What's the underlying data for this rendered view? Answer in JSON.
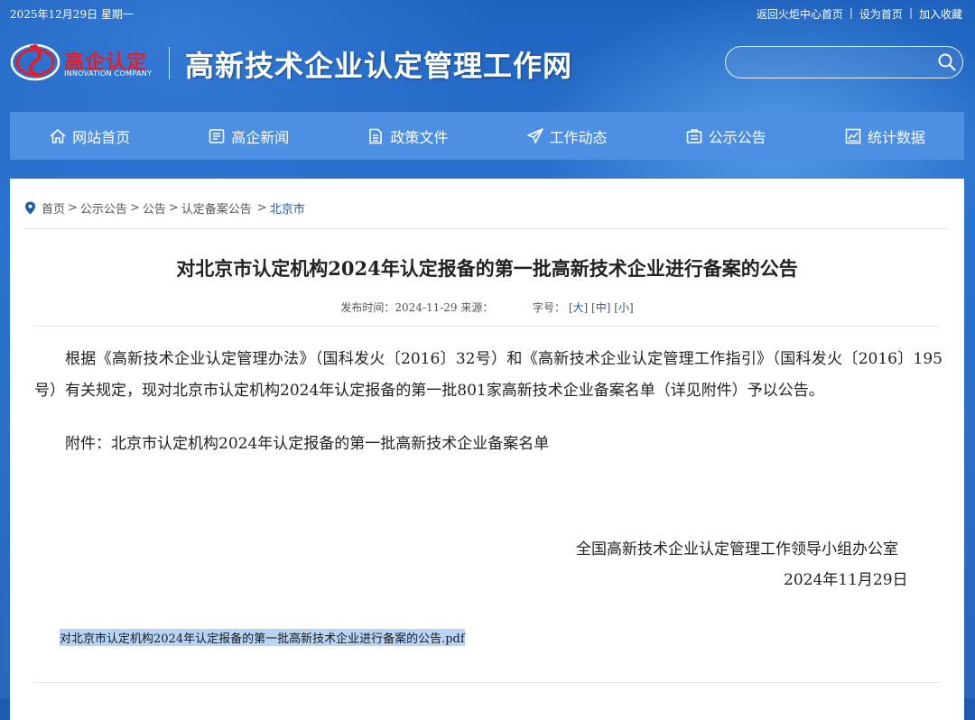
{
  "topbar": {
    "date": "2025年12月29日 星期一",
    "links": [
      "返回火炬中心首页",
      "设为首页",
      "加入收藏"
    ]
  },
  "logo": {
    "cn": "高企认定",
    "en": "INNOVATION COMPANY"
  },
  "site_title": "高新技术企业认定管理工作网",
  "search": {
    "placeholder": ""
  },
  "nav": [
    {
      "label": "网站首页",
      "icon": "home-icon"
    },
    {
      "label": "高企新闻",
      "icon": "news-icon"
    },
    {
      "label": "政策文件",
      "icon": "document-icon"
    },
    {
      "label": "工作动态",
      "icon": "paper-plane-icon"
    },
    {
      "label": "公示公告",
      "icon": "notice-icon"
    },
    {
      "label": "统计数据",
      "icon": "chart-icon"
    }
  ],
  "breadcrumb": [
    "首页",
    "公示公告",
    "公告",
    "认定备案公告"
  ],
  "breadcrumb_current": "北京市",
  "article": {
    "title": "对北京市认定机构2024年认定报备的第一批高新技术企业进行备案的公告",
    "meta_prefix": "发布时间：2024-11-29 来源：",
    "font_label": "字号：",
    "font_sizes": [
      "大",
      "中",
      "小"
    ],
    "paragraph": "根据《高新技术企业认定管理办法》（国科发火〔2016〕32号）和《高新技术企业认定管理工作指引》（国科发火〔2016〕195号）有关规定，现对北京市认定机构2024年认定报备的第一批801家高新技术企业备案名单（详见附件）予以公告。",
    "attachment": "附件：北京市认定机构2024年认定报备的第一批高新技术企业备案名单",
    "signature": "全国高新技术企业认定管理工作领导小组办公室",
    "sign_date": "2024年11月29日",
    "pdf_link": "对北京市认定机构2024年认定报备的第一批高新技术企业进行备案的公告.pdf"
  },
  "colors": {
    "brand_blue": "#1c5bb0",
    "nav_blue": "#4d8fe3",
    "logo_red": "#e51d2a"
  }
}
